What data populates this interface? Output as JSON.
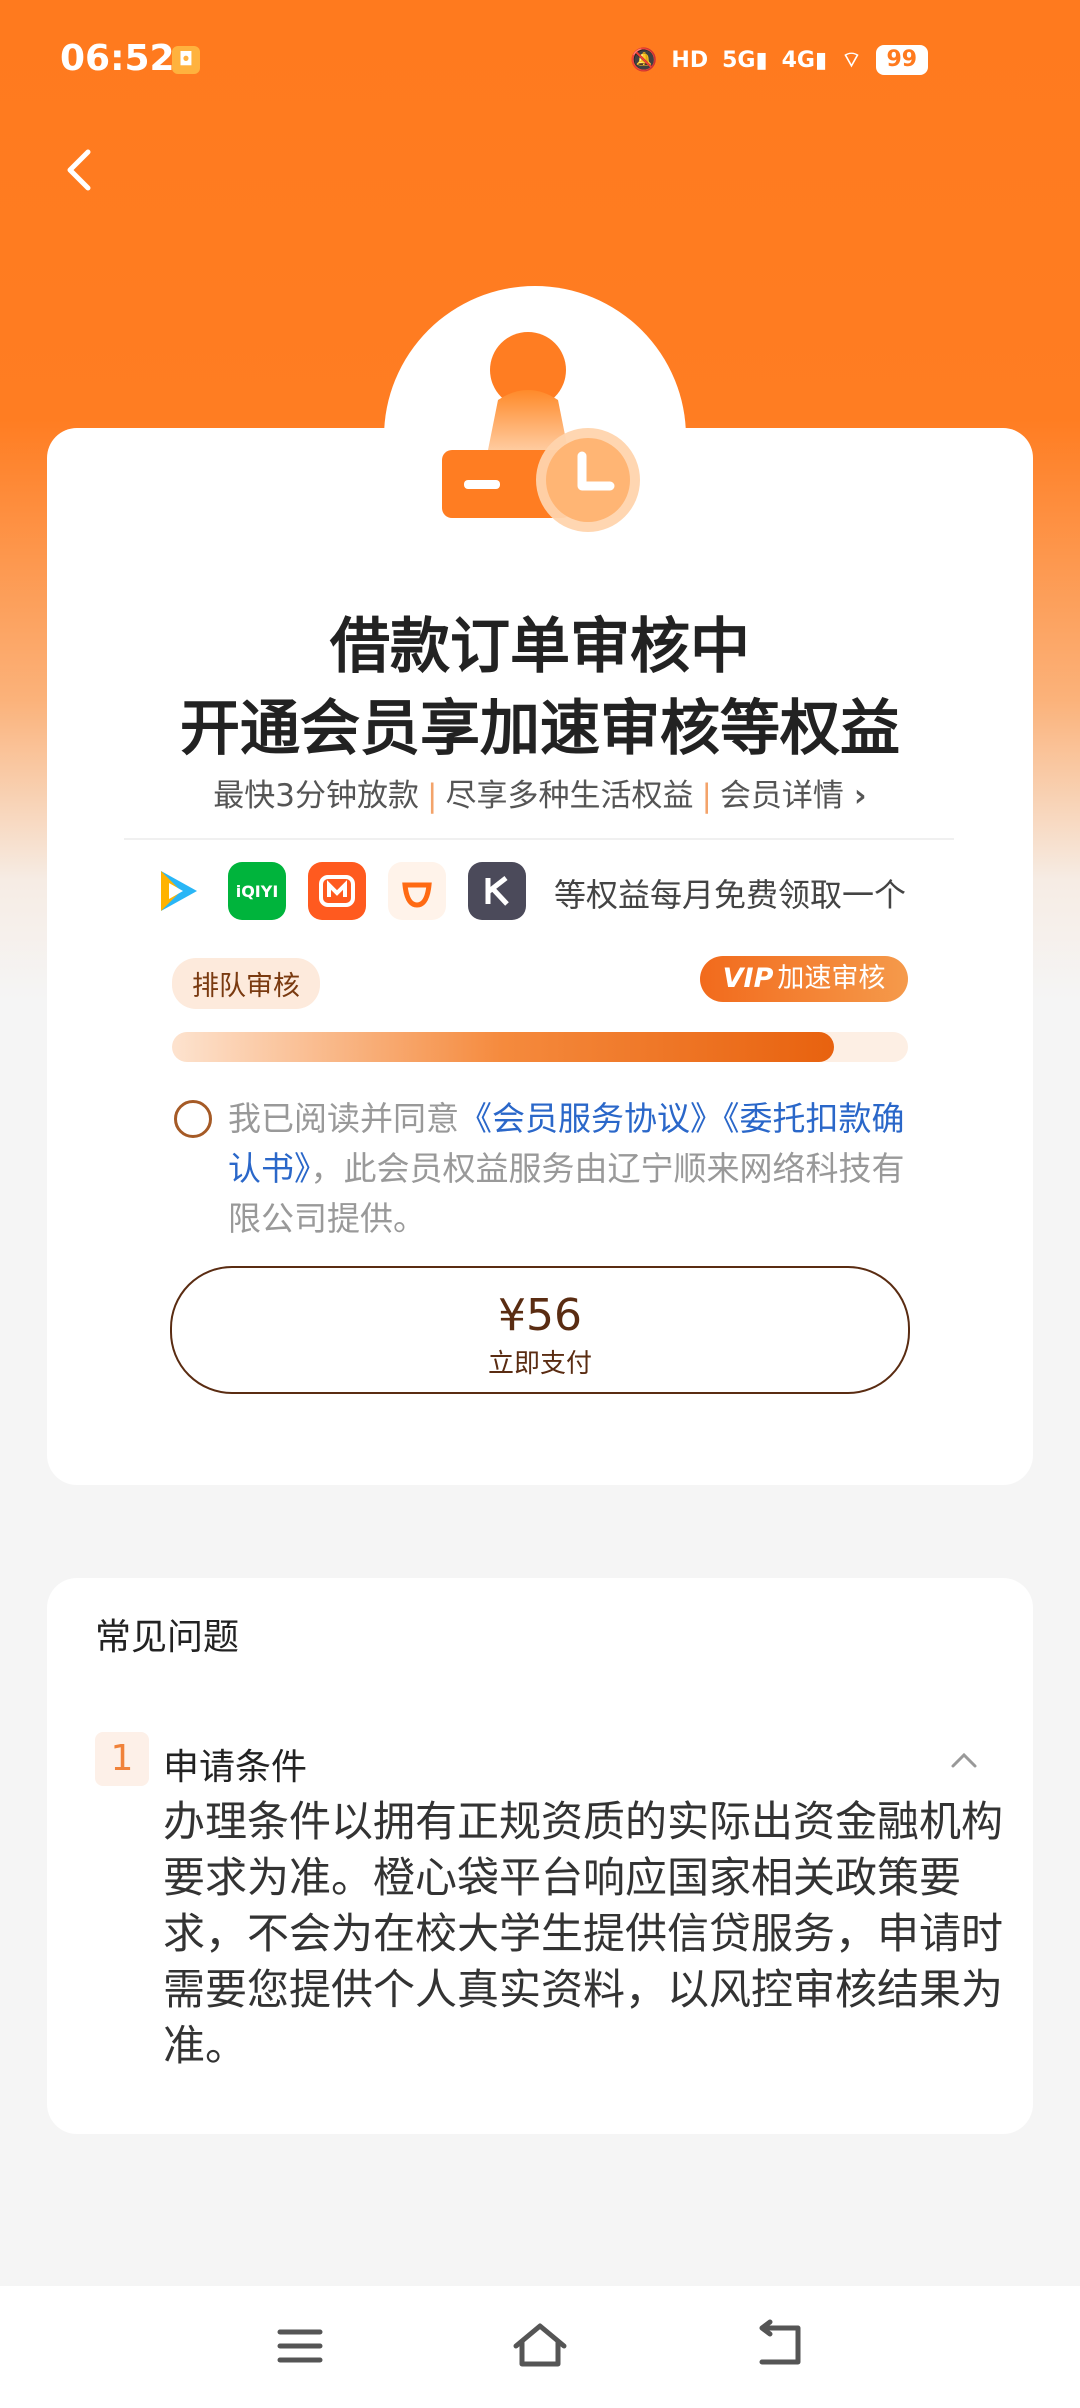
{
  "status": {
    "time": "06:52",
    "battery": "99"
  },
  "hero": {
    "title_line1": "借款订单审核中",
    "title_line2": "开通会员享加速审核等权益",
    "sub_item1": "最快3分钟放款",
    "sub_item2": "尽享多种生活权益",
    "sub_item3": "会员详情"
  },
  "apps": {
    "items": [
      {
        "name": "tencent-video",
        "color": "#ffffff"
      },
      {
        "name": "iqiyi",
        "label": "iQIYI",
        "color": "#00b43c"
      },
      {
        "name": "mango-tv",
        "color": "#ff5a1f"
      },
      {
        "name": "didi",
        "color": "#fff3ea"
      },
      {
        "name": "keep",
        "color": "#4b4a5a"
      }
    ],
    "text": "等权益每月免费领取一个"
  },
  "progress": {
    "queue_label": "排队审核",
    "vip_prefix": "VIP",
    "vip_label": "加速审核",
    "fill": 0.9
  },
  "agreement": {
    "prefix": "我已阅读并同意",
    "link1": "《会员服务协议》",
    "link2": "《委托扣款确认书》",
    "suffix": "，此会员权益服务由辽宁顺来网络科技有限公司提供。"
  },
  "pay": {
    "price": "¥56",
    "label": "立即支付"
  },
  "faq": {
    "title": "常见问题",
    "items": [
      {
        "num": "1",
        "question": "申请条件",
        "answer": "办理条件以拥有正规资质的实际出资金融机构要求为准。橙心袋平台响应国家相关政策要求，不会为在校大学生提供信贷服务，申请时需要您提供个人真实资料，以风控审核结果为准。"
      }
    ]
  },
  "colors": {
    "accent": "#ff7a1e",
    "link": "#2a67c9",
    "brown": "#5a2c12"
  }
}
